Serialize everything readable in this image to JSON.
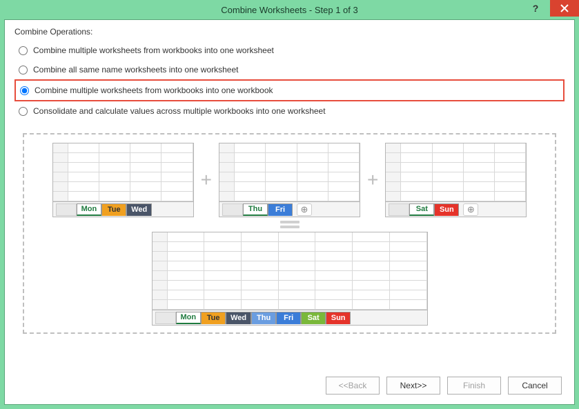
{
  "titlebar": {
    "title": "Combine Worksheets - Step 1 of 3"
  },
  "section_label": "Combine Operations:",
  "options": {
    "opt0": "Combine multiple worksheets from workbooks into one worksheet",
    "opt1": "Combine all same name worksheets into one worksheet",
    "opt2": "Combine multiple worksheets from workbooks into one workbook",
    "opt3": "Consolidate and calculate values across multiple workbooks into one worksheet"
  },
  "diagram": {
    "wb1_tabs": [
      "Mon",
      "Tue",
      "Wed"
    ],
    "wb2_tabs": [
      "Thu",
      "Fri"
    ],
    "wb3_tabs": [
      "Sat",
      "Sun"
    ],
    "result_tabs": [
      "Mon",
      "Tue",
      "Wed",
      "Thu",
      "Fri",
      "Sat",
      "Sun"
    ]
  },
  "buttons": {
    "back": "<<Back",
    "next": "Next>>",
    "finish": "Finish",
    "cancel": "Cancel"
  }
}
